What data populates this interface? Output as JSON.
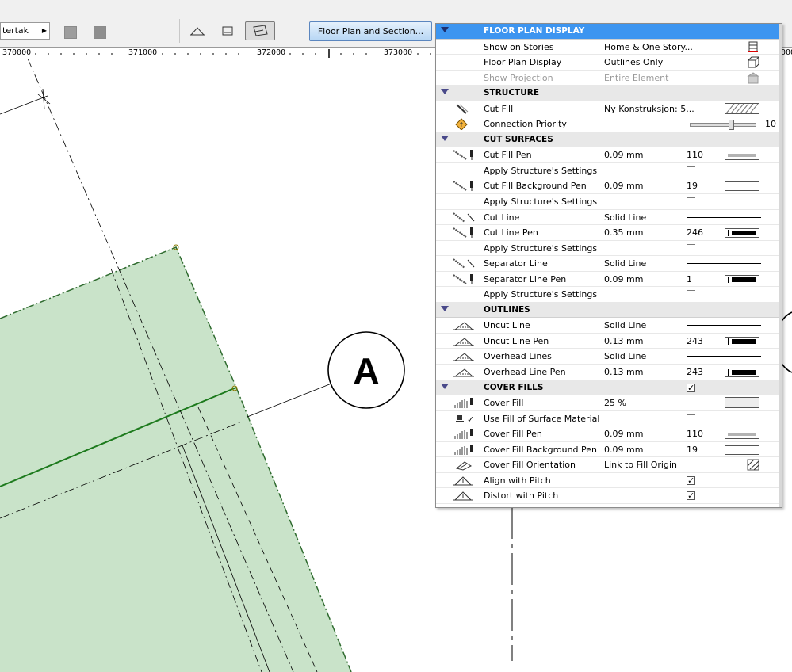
{
  "toolbar": {
    "layer_dropdown": "tertak",
    "floor_plan_section_button": "Floor Plan and Section..."
  },
  "ruler": {
    "labels": [
      "370000",
      "371000",
      "372000",
      "373000",
      "000"
    ]
  },
  "canvas": {
    "marker_label": "A"
  },
  "panel": {
    "rows": [
      {
        "type": "header",
        "title": "FLOOR PLAN DISPLAY",
        "first": true
      },
      {
        "type": "item",
        "icon": "stories-icon",
        "label": "Show on Stories",
        "value": "Home & One Story...",
        "right": "stories"
      },
      {
        "type": "item",
        "icon": "",
        "label": "Floor Plan Display",
        "value": "Outlines Only",
        "right": "cube"
      },
      {
        "type": "item",
        "icon": "",
        "label": "Show Projection",
        "value": "Entire Element",
        "right": "projection",
        "dim": true
      },
      {
        "type": "header",
        "title": "STRUCTURE"
      },
      {
        "type": "item",
        "icon": "cut-fill-icon",
        "label": "Cut Fill",
        "value": "Ny Konstruksjon: 5...",
        "right": "hatch"
      },
      {
        "type": "item",
        "icon": "priority-icon",
        "label": "Connection Priority",
        "slider": true,
        "slider_value": "10"
      },
      {
        "type": "header",
        "title": "CUT SURFACES"
      },
      {
        "type": "item",
        "icon": "pen-icon",
        "label": "Cut Fill Pen",
        "value": "0.09 mm",
        "num": "110",
        "pen": "#b3b3b3"
      },
      {
        "type": "item",
        "icon": "",
        "label": "Apply Structure's Settings",
        "checkbox": "empty"
      },
      {
        "type": "item",
        "icon": "pen-icon",
        "label": "Cut Fill Background Pen",
        "value": "0.09 mm",
        "num": "19",
        "pen": "#ffffff"
      },
      {
        "type": "item",
        "icon": "",
        "label": "Apply Structure's Settings",
        "checkbox": "empty"
      },
      {
        "type": "item",
        "icon": "line-icon",
        "label": "Cut Line",
        "value": "Solid Line",
        "line": true
      },
      {
        "type": "item",
        "icon": "pen-icon",
        "label": "Cut Line Pen",
        "value": "0.35 mm",
        "num": "246",
        "pen": "#000000"
      },
      {
        "type": "item",
        "icon": "",
        "label": "Apply Structure's Settings",
        "checkbox": "empty"
      },
      {
        "type": "item",
        "icon": "line-icon",
        "label": "Separator Line",
        "value": "Solid Line",
        "line": true
      },
      {
        "type": "item",
        "icon": "pen-icon",
        "label": "Separator Line Pen",
        "value": "0.09 mm",
        "num": "1",
        "pen": "#000000"
      },
      {
        "type": "item",
        "icon": "",
        "label": "Apply Structure's Settings",
        "checkbox": "empty"
      },
      {
        "type": "header",
        "title": "OUTLINES"
      },
      {
        "type": "item",
        "icon": "outline-icon",
        "label": "Uncut Line",
        "value": "Solid Line",
        "line": true
      },
      {
        "type": "item",
        "icon": "outline-icon",
        "label": "Uncut Line Pen",
        "value": "0.13 mm",
        "num": "243",
        "pen": "#000000"
      },
      {
        "type": "item",
        "icon": "outline-icon",
        "label": "Overhead Lines",
        "value": "Solid Line",
        "line": true
      },
      {
        "type": "item",
        "icon": "outline-icon",
        "label": "Overhead Line Pen",
        "value": "0.13 mm",
        "num": "243",
        "pen": "#000000"
      },
      {
        "type": "header",
        "title": "COVER FILLS",
        "checkbox": "checked"
      },
      {
        "type": "item",
        "icon": "cover-icon",
        "label": "Cover Fill",
        "value": "25 %",
        "right": "dots"
      },
      {
        "type": "item",
        "icon": "material-icon",
        "label": "Use Fill of Surface Material",
        "checkbox": "empty"
      },
      {
        "type": "item",
        "icon": "cover-icon",
        "label": "Cover Fill Pen",
        "value": "0.09 mm",
        "num": "110",
        "pen": "#b3b3b3"
      },
      {
        "type": "item",
        "icon": "cover-icon",
        "label": "Cover Fill Background Pen",
        "value": "0.09 mm",
        "num": "19",
        "pen": "#ffffff"
      },
      {
        "type": "item",
        "icon": "orientation-icon",
        "label": "Cover Fill Orientation",
        "value": "Link to Fill Origin",
        "right": "orient"
      },
      {
        "type": "item",
        "icon": "pitch-icon",
        "label": "Align with Pitch",
        "checkbox": "checked"
      },
      {
        "type": "item",
        "icon": "pitch-icon",
        "label": "Distort with Pitch",
        "checkbox": "checked"
      }
    ]
  }
}
